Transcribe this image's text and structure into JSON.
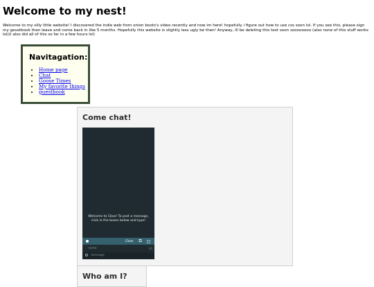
{
  "page": {
    "title": "Welcome to my nest!",
    "intro": "Welcome to my silly little website! I discovered the indie web from onion boots's video recently and now im here! hopefully i figure out how to use css soon lol. If you see this, please sign my geustbook then leave and come back in like 5 months. Hopefully this website is slightly less ugly be then! Anyway, Ill be deleting this text soon soooooooo (also none of this stuff works lol)(I also did all of this so far in a few hours lol)"
  },
  "nav": {
    "title": "Navitagation:",
    "items": [
      {
        "label": "Home page"
      },
      {
        "label": "Chat"
      },
      {
        "label": "Goose Times"
      },
      {
        "label": "My favorite things"
      },
      {
        "label": "guestbook"
      }
    ]
  },
  "chat": {
    "title": "Come chat!",
    "widget": {
      "welcome": "Welcome to Cbox! To post a message, click in the boxes below and type!",
      "brand": "Cbox",
      "name_placeholder": "name",
      "message_placeholder": "message",
      "char_count": "40"
    }
  },
  "about": {
    "title": "Who am I?"
  },
  "colors": {
    "nav_border": "#394d36",
    "nav_background": "#fffff0",
    "chat_dark": "#1f2b30",
    "chat_bar": "#35606e",
    "link": "#0000ee"
  },
  "icons": [
    "person-icon",
    "external-link-icon",
    "gear-icon"
  ]
}
